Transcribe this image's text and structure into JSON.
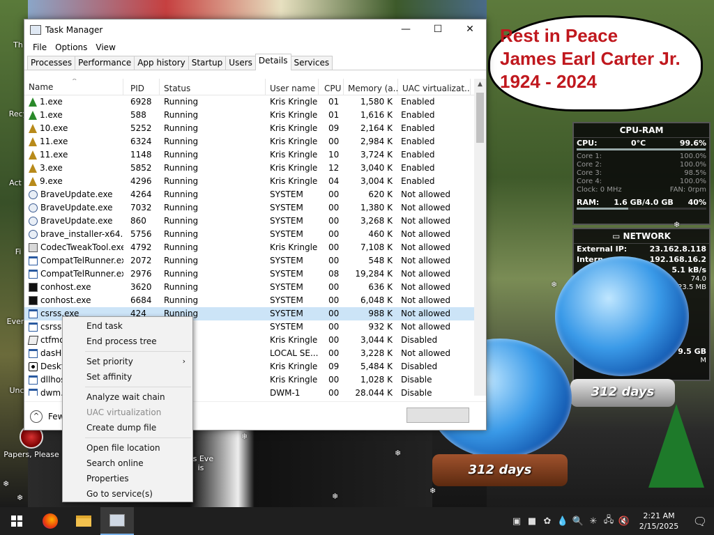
{
  "desktop": {
    "icons": [
      {
        "label": "Th"
      },
      {
        "label": "Recy"
      },
      {
        "label": "Act"
      },
      {
        "label": "Fi"
      },
      {
        "label": "Ever"
      },
      {
        "label": "Unc"
      },
      {
        "label": "Papers, Please"
      },
      {
        "label": "as Eve"
      },
      {
        "label": "is"
      }
    ],
    "banner": {
      "line1": "Rest in Peace",
      "line2": "James Earl Carter Jr.",
      "line3": "1924 - 2024"
    },
    "globe_label_1": "312 days",
    "globe_label_2": "312 days"
  },
  "gadget_cpu": {
    "title": "CPU-RAM",
    "cpu_label": "CPU:",
    "cpu_temp": "0°C",
    "cpu_value": "99.6%",
    "cores": [
      {
        "label": "Core 1:",
        "value": "100.0%"
      },
      {
        "label": "Core 2:",
        "value": "100.0%"
      },
      {
        "label": "Core 3:",
        "value": "98.5%"
      },
      {
        "label": "Core 4:",
        "value": "100.0%"
      }
    ],
    "clock": "Clock: 0 MHz",
    "fan": "FAN: 0rpm",
    "ram_label": "RAM:",
    "ram_value": "1.6 GB/4.0 GB",
    "ram_pct": "40%"
  },
  "gadget_net": {
    "title": "NETWORK",
    "ext_ip_label": "External IP:",
    "ext_ip": "23.162.8.118",
    "int_ip_label": "Intern",
    "int_ip": "192.168.16.2",
    "speed1": "5.1 kB/s",
    "speed2": "74.0",
    "speed3": "23.5 MB",
    "extra1": "9.5 GB",
    "extra2": "M"
  },
  "taskmgr": {
    "title": "Task Manager",
    "menu": [
      "File",
      "Options",
      "View"
    ],
    "tabs": [
      "Processes",
      "Performance",
      "App history",
      "Startup",
      "Users",
      "Details",
      "Services"
    ],
    "active_tab": "Details",
    "columns": [
      "Name",
      "PID",
      "Status",
      "User name",
      "CPU",
      "Memory (a...",
      "UAC virtualizat..."
    ],
    "rows": [
      {
        "icon": "tree",
        "name": "1.exe",
        "pid": "6928",
        "status": "Running",
        "user": "Kris Kringle",
        "cpu": "01",
        "mem": "1,580 K",
        "uac": "Enabled"
      },
      {
        "icon": "tree",
        "name": "1.exe",
        "pid": "588",
        "status": "Running",
        "user": "Kris Kringle",
        "cpu": "01",
        "mem": "1,616 K",
        "uac": "Enabled"
      },
      {
        "icon": "gold",
        "name": "10.exe",
        "pid": "5252",
        "status": "Running",
        "user": "Kris Kringle",
        "cpu": "09",
        "mem": "2,164 K",
        "uac": "Enabled"
      },
      {
        "icon": "gold",
        "name": "11.exe",
        "pid": "6324",
        "status": "Running",
        "user": "Kris Kringle",
        "cpu": "00",
        "mem": "2,984 K",
        "uac": "Enabled"
      },
      {
        "icon": "gold",
        "name": "11.exe",
        "pid": "1148",
        "status": "Running",
        "user": "Kris Kringle",
        "cpu": "10",
        "mem": "3,724 K",
        "uac": "Enabled"
      },
      {
        "icon": "gold",
        "name": "3.exe",
        "pid": "5852",
        "status": "Running",
        "user": "Kris Kringle",
        "cpu": "12",
        "mem": "3,040 K",
        "uac": "Enabled"
      },
      {
        "icon": "gold",
        "name": "9.exe",
        "pid": "4296",
        "status": "Running",
        "user": "Kris Kringle",
        "cpu": "04",
        "mem": "3,004 K",
        "uac": "Enabled"
      },
      {
        "icon": "brave",
        "name": "BraveUpdate.exe",
        "pid": "4264",
        "status": "Running",
        "user": "SYSTEM",
        "cpu": "00",
        "mem": "620 K",
        "uac": "Not allowed"
      },
      {
        "icon": "brave",
        "name": "BraveUpdate.exe",
        "pid": "7032",
        "status": "Running",
        "user": "SYSTEM",
        "cpu": "00",
        "mem": "1,380 K",
        "uac": "Not allowed"
      },
      {
        "icon": "brave",
        "name": "BraveUpdate.exe",
        "pid": "860",
        "status": "Running",
        "user": "SYSTEM",
        "cpu": "00",
        "mem": "3,268 K",
        "uac": "Not allowed"
      },
      {
        "icon": "brave",
        "name": "brave_installer-x64.exe",
        "pid": "5756",
        "status": "Running",
        "user": "SYSTEM",
        "cpu": "00",
        "mem": "460 K",
        "uac": "Not allowed"
      },
      {
        "icon": "codec",
        "name": "CodecTweakTool.exe",
        "pid": "4792",
        "status": "Running",
        "user": "Kris Kringle",
        "cpu": "00",
        "mem": "7,108 K",
        "uac": "Not allowed"
      },
      {
        "icon": "win",
        "name": "CompatTelRunner.exe",
        "pid": "2072",
        "status": "Running",
        "user": "SYSTEM",
        "cpu": "00",
        "mem": "548 K",
        "uac": "Not allowed"
      },
      {
        "icon": "win",
        "name": "CompatTelRunner.exe",
        "pid": "2976",
        "status": "Running",
        "user": "SYSTEM",
        "cpu": "08",
        "mem": "19,284 K",
        "uac": "Not allowed"
      },
      {
        "icon": "con",
        "name": "conhost.exe",
        "pid": "3620",
        "status": "Running",
        "user": "SYSTEM",
        "cpu": "00",
        "mem": "636 K",
        "uac": "Not allowed"
      },
      {
        "icon": "con",
        "name": "conhost.exe",
        "pid": "6684",
        "status": "Running",
        "user": "SYSTEM",
        "cpu": "00",
        "mem": "6,048 K",
        "uac": "Not allowed"
      },
      {
        "icon": "win",
        "name": "csrss.exe",
        "pid": "424",
        "status": "Running",
        "user": "SYSTEM",
        "cpu": "00",
        "mem": "988 K",
        "uac": "Not allowed",
        "selected": true
      },
      {
        "icon": "win",
        "name": "csrss.e",
        "pid": "",
        "status": "",
        "user": "SYSTEM",
        "cpu": "00",
        "mem": "932 K",
        "uac": "Not allowed"
      },
      {
        "icon": "pen",
        "name": "ctfmo",
        "pid": "",
        "status": "",
        "user": "Kris Kringle",
        "cpu": "00",
        "mem": "3,044 K",
        "uac": "Disabled"
      },
      {
        "icon": "win",
        "name": "dasHo",
        "pid": "",
        "status": "",
        "user": "LOCAL SE...",
        "cpu": "00",
        "mem": "3,228 K",
        "uac": "Not allowed"
      },
      {
        "icon": "star",
        "name": "Deskto",
        "pid": "",
        "status": "",
        "user": "Kris Kringle",
        "cpu": "09",
        "mem": "5,484 K",
        "uac": "Disabled"
      },
      {
        "icon": "win",
        "name": "dllhos",
        "pid": "",
        "status": "",
        "user": "Kris Kringle",
        "cpu": "00",
        "mem": "1,028 K",
        "uac": "Disable"
      },
      {
        "icon": "win",
        "name": "dwm.e",
        "pid": "",
        "status": "",
        "user": "DWM-1",
        "cpu": "00",
        "mem": "28,044 K",
        "uac": "Disable"
      }
    ],
    "footer_label": "Few"
  },
  "context_menu": {
    "items": [
      {
        "label": "End task",
        "disabled": false
      },
      {
        "label": "End process tree",
        "disabled": false
      },
      {
        "sep": true
      },
      {
        "label": "Set priority",
        "submenu": true
      },
      {
        "label": "Set affinity"
      },
      {
        "sep": true
      },
      {
        "label": "Analyze wait chain"
      },
      {
        "label": "UAC virtualization",
        "disabled": true
      },
      {
        "label": "Create dump file"
      },
      {
        "sep": true
      },
      {
        "label": "Open file location"
      },
      {
        "label": "Search online"
      },
      {
        "label": "Properties"
      },
      {
        "label": "Go to service(s)"
      }
    ]
  },
  "taskbar": {
    "time": "2:21 AM",
    "date": "2/15/2025"
  }
}
